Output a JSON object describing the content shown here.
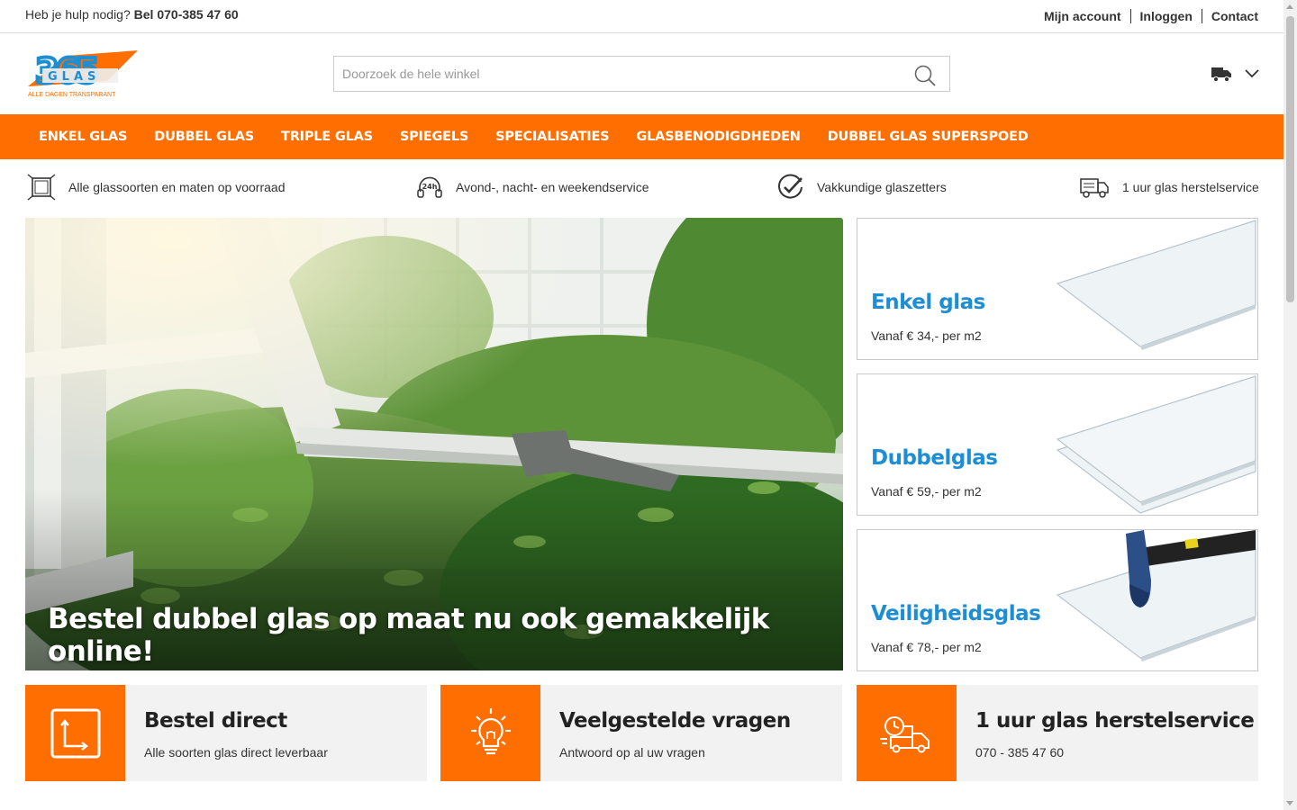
{
  "topbar": {
    "help_text": "Heb je hulp nodig?",
    "phone": "Bel 070-385 47 60",
    "links": [
      "Mijn account",
      "Inloggen",
      "Contact"
    ]
  },
  "logo": {
    "number": "365",
    "word": "GLAS",
    "tagline": "ALLE DAGEN TRANSPARANT"
  },
  "search": {
    "placeholder": "Doorzoek de hele winkel",
    "icon": "search-icon"
  },
  "cart": {
    "icon": "truck-icon",
    "dropdown_icon": "chevron-down-icon"
  },
  "nav": {
    "items": [
      "ENKEL GLAS",
      "DUBBEL GLAS",
      "TRIPLE GLAS",
      "SPIEGELS",
      "SPECIALISATIES",
      "GLASBENODIGDHEDEN",
      "DUBBEL GLAS SUPERSPOED"
    ]
  },
  "usps": [
    {
      "icon": "frame-icon",
      "text": "Alle glassoorten en maten op voorraad"
    },
    {
      "icon": "24h-service-icon",
      "text": "Avond-, nacht- en weekendservice"
    },
    {
      "icon": "check-icon",
      "text": "Vakkundige glaszetters"
    },
    {
      "icon": "van-icon",
      "text": "1 uur glas herstelservice"
    }
  ],
  "hero": {
    "title": "Bestel dubbel glas op maat nu ook gemakkelijk online!"
  },
  "products": [
    {
      "title": "Enkel glas",
      "price": "Vanaf € 34,- per m2"
    },
    {
      "title": "Dubbelglas",
      "price": "Vanaf € 59,- per m2"
    },
    {
      "title": "Veiligheidsglas",
      "price": "Vanaf € 78,- per m2"
    }
  ],
  "info": [
    {
      "icon": "resize-icon",
      "title": "Bestel direct",
      "subtitle": "Alle soorten glas direct leverbaar"
    },
    {
      "icon": "lightbulb-icon",
      "title": "Veelgestelde vragen",
      "subtitle": "Antwoord op al uw vragen"
    },
    {
      "icon": "fast-delivery-icon",
      "title": "1 uur glas herstelservice",
      "subtitle": "070 - 385 47 60"
    }
  ],
  "colors": {
    "brand_orange": "#ff6e00",
    "brand_blue": "#1e8ed4"
  }
}
